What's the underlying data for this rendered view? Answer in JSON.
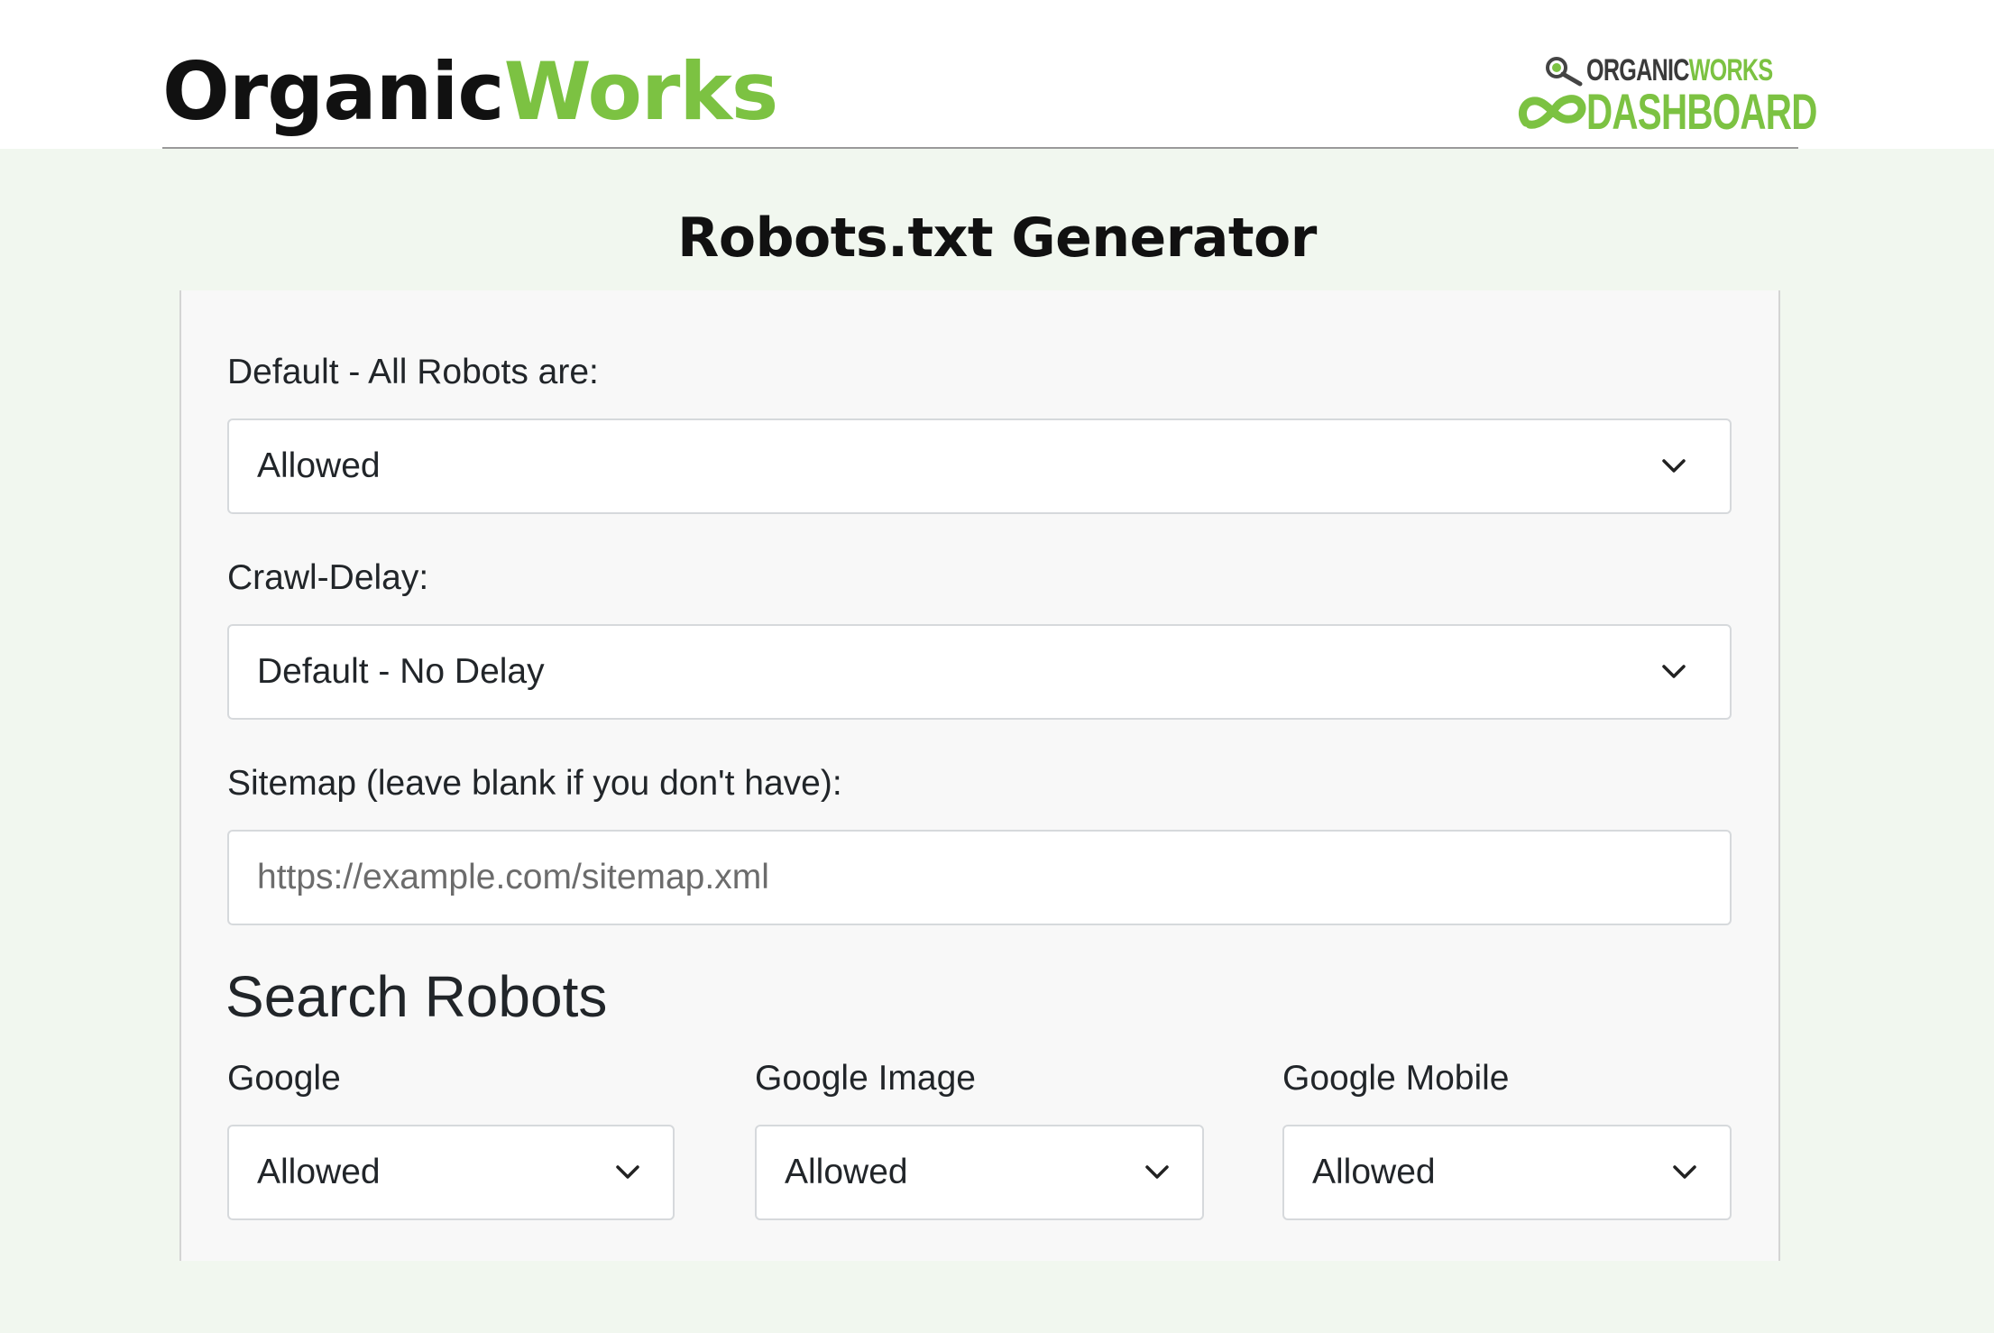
{
  "header": {
    "brand_part1": "Organic",
    "brand_part2": "Works",
    "brand_color_dark": "#111111",
    "brand_color_green": "#7cc242",
    "dashboard_logo_top_part1": "ORGANIC",
    "dashboard_logo_top_part2": "WORKS",
    "dashboard_logo_bottom": "DASHBOARD"
  },
  "page": {
    "title": "Robots.txt Generator",
    "background": "#f1f7ef"
  },
  "form": {
    "default_robots": {
      "label": "Default - All Robots are:",
      "value": "Allowed"
    },
    "crawl_delay": {
      "label": "Crawl-Delay:",
      "value": "Default - No Delay"
    },
    "sitemap": {
      "label": "Sitemap (leave blank if you don't have):",
      "value": "",
      "placeholder": "https://example.com/sitemap.xml"
    },
    "search_robots": {
      "title": "Search Robots",
      "robots": [
        {
          "label": "Google",
          "value": "Allowed"
        },
        {
          "label": "Google Image",
          "value": "Allowed"
        },
        {
          "label": "Google Mobile",
          "value": "Allowed"
        }
      ]
    }
  },
  "icons": {
    "dropdown": "chevron-down-icon",
    "logo_search": "magnifier-icon",
    "logo_mark": "infinity-icon"
  }
}
